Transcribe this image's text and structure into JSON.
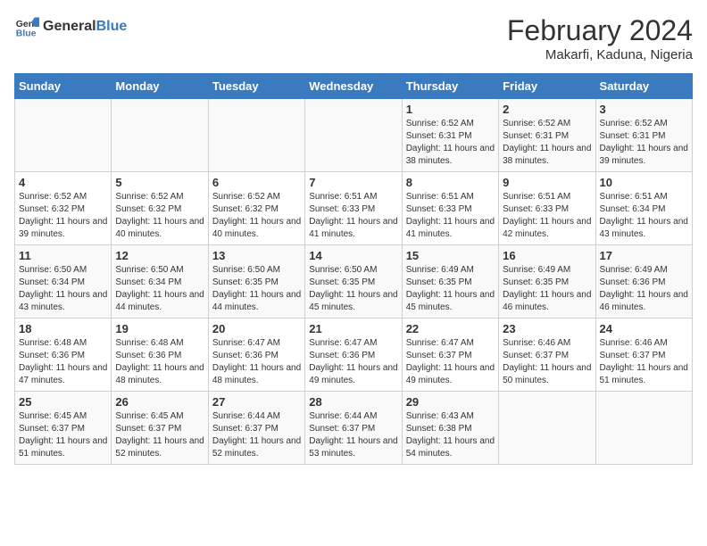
{
  "header": {
    "logo_general": "General",
    "logo_blue": "Blue",
    "month_year": "February 2024",
    "location": "Makarfi, Kaduna, Nigeria"
  },
  "days_of_week": [
    "Sunday",
    "Monday",
    "Tuesday",
    "Wednesday",
    "Thursday",
    "Friday",
    "Saturday"
  ],
  "weeks": [
    [
      {
        "day": "",
        "info": ""
      },
      {
        "day": "",
        "info": ""
      },
      {
        "day": "",
        "info": ""
      },
      {
        "day": "",
        "info": ""
      },
      {
        "day": "1",
        "info": "Sunrise: 6:52 AM\nSunset: 6:31 PM\nDaylight: 11 hours and 38 minutes."
      },
      {
        "day": "2",
        "info": "Sunrise: 6:52 AM\nSunset: 6:31 PM\nDaylight: 11 hours and 38 minutes."
      },
      {
        "day": "3",
        "info": "Sunrise: 6:52 AM\nSunset: 6:31 PM\nDaylight: 11 hours and 39 minutes."
      }
    ],
    [
      {
        "day": "4",
        "info": "Sunrise: 6:52 AM\nSunset: 6:32 PM\nDaylight: 11 hours and 39 minutes."
      },
      {
        "day": "5",
        "info": "Sunrise: 6:52 AM\nSunset: 6:32 PM\nDaylight: 11 hours and 40 minutes."
      },
      {
        "day": "6",
        "info": "Sunrise: 6:52 AM\nSunset: 6:32 PM\nDaylight: 11 hours and 40 minutes."
      },
      {
        "day": "7",
        "info": "Sunrise: 6:51 AM\nSunset: 6:33 PM\nDaylight: 11 hours and 41 minutes."
      },
      {
        "day": "8",
        "info": "Sunrise: 6:51 AM\nSunset: 6:33 PM\nDaylight: 11 hours and 41 minutes."
      },
      {
        "day": "9",
        "info": "Sunrise: 6:51 AM\nSunset: 6:33 PM\nDaylight: 11 hours and 42 minutes."
      },
      {
        "day": "10",
        "info": "Sunrise: 6:51 AM\nSunset: 6:34 PM\nDaylight: 11 hours and 43 minutes."
      }
    ],
    [
      {
        "day": "11",
        "info": "Sunrise: 6:50 AM\nSunset: 6:34 PM\nDaylight: 11 hours and 43 minutes."
      },
      {
        "day": "12",
        "info": "Sunrise: 6:50 AM\nSunset: 6:34 PM\nDaylight: 11 hours and 44 minutes."
      },
      {
        "day": "13",
        "info": "Sunrise: 6:50 AM\nSunset: 6:35 PM\nDaylight: 11 hours and 44 minutes."
      },
      {
        "day": "14",
        "info": "Sunrise: 6:50 AM\nSunset: 6:35 PM\nDaylight: 11 hours and 45 minutes."
      },
      {
        "day": "15",
        "info": "Sunrise: 6:49 AM\nSunset: 6:35 PM\nDaylight: 11 hours and 45 minutes."
      },
      {
        "day": "16",
        "info": "Sunrise: 6:49 AM\nSunset: 6:35 PM\nDaylight: 11 hours and 46 minutes."
      },
      {
        "day": "17",
        "info": "Sunrise: 6:49 AM\nSunset: 6:36 PM\nDaylight: 11 hours and 46 minutes."
      }
    ],
    [
      {
        "day": "18",
        "info": "Sunrise: 6:48 AM\nSunset: 6:36 PM\nDaylight: 11 hours and 47 minutes."
      },
      {
        "day": "19",
        "info": "Sunrise: 6:48 AM\nSunset: 6:36 PM\nDaylight: 11 hours and 48 minutes."
      },
      {
        "day": "20",
        "info": "Sunrise: 6:47 AM\nSunset: 6:36 PM\nDaylight: 11 hours and 48 minutes."
      },
      {
        "day": "21",
        "info": "Sunrise: 6:47 AM\nSunset: 6:36 PM\nDaylight: 11 hours and 49 minutes."
      },
      {
        "day": "22",
        "info": "Sunrise: 6:47 AM\nSunset: 6:37 PM\nDaylight: 11 hours and 49 minutes."
      },
      {
        "day": "23",
        "info": "Sunrise: 6:46 AM\nSunset: 6:37 PM\nDaylight: 11 hours and 50 minutes."
      },
      {
        "day": "24",
        "info": "Sunrise: 6:46 AM\nSunset: 6:37 PM\nDaylight: 11 hours and 51 minutes."
      }
    ],
    [
      {
        "day": "25",
        "info": "Sunrise: 6:45 AM\nSunset: 6:37 PM\nDaylight: 11 hours and 51 minutes."
      },
      {
        "day": "26",
        "info": "Sunrise: 6:45 AM\nSunset: 6:37 PM\nDaylight: 11 hours and 52 minutes."
      },
      {
        "day": "27",
        "info": "Sunrise: 6:44 AM\nSunset: 6:37 PM\nDaylight: 11 hours and 52 minutes."
      },
      {
        "day": "28",
        "info": "Sunrise: 6:44 AM\nSunset: 6:37 PM\nDaylight: 11 hours and 53 minutes."
      },
      {
        "day": "29",
        "info": "Sunrise: 6:43 AM\nSunset: 6:38 PM\nDaylight: 11 hours and 54 minutes."
      },
      {
        "day": "",
        "info": ""
      },
      {
        "day": "",
        "info": ""
      }
    ]
  ]
}
